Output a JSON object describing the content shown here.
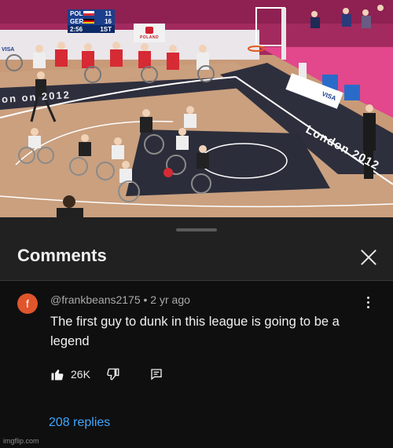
{
  "video": {
    "scoreboard": {
      "home_team": "POL",
      "home_score": "11",
      "away_team": "GER",
      "away_score": "16",
      "clock": "2:56",
      "period": "1ST"
    },
    "banner_text": "POLAND",
    "court_text_left": "on  on  2012",
    "court_text_right": "London 2012",
    "board_text": "VISA",
    "ad_text": "VISA",
    "colors": {
      "court": "#c89a78",
      "arena": "#b8316b",
      "paint": "#2b2d3a",
      "team_red": "#d62a35",
      "team_white": "#eeeeee"
    }
  },
  "sheet": {
    "title": "Comments",
    "close_icon": "close-icon"
  },
  "comment": {
    "avatar_letter": "f",
    "avatar_color": "#e0552b",
    "meta": "@frankbeans2175 • 2 yr ago",
    "text": "The first guy to dunk in this league is going to be a legend",
    "like_count": "26K",
    "replies_label": "208 replies"
  },
  "watermark": "imgflip.com"
}
